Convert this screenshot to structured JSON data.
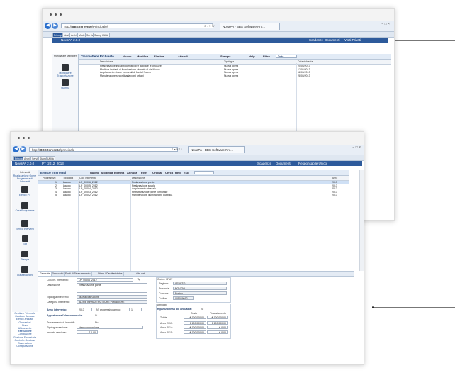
{
  "callouts": {
    "colors": {
      "line": "#777777",
      "dot": "#222222"
    }
  },
  "window_back": {
    "address": {
      "host": "http://",
      "bold": "BBSItervento",
      "rest": "/Principale/"
    },
    "address_controls": "⌕ ▾ × ↻",
    "tab_label": "NovaPA - BBS Software Pro...",
    "win_controls": "− □ ×",
    "app_tabs": [
      "Principale",
      "Novità",
      "Archivi",
      "Modelli",
      "Servizi",
      "Stampe",
      "Utilità"
    ],
    "brand": "NovaPA 2.0.0",
    "header_right": [
      "Scadenze",
      "Documenti",
      "Visiti Privati"
    ],
    "sidebar": {
      "title": "Mondialare Manager",
      "tool1": "Mondialare Trasportazione",
      "tool2": "Stampa"
    },
    "panel_title": "Trasmettere Richieste",
    "toolbar": [
      "Nuovo",
      "Modifica",
      "Elimina",
      "Attendi",
      "Stampa",
      "Help",
      "Filtro"
    ],
    "filter_value": "Tutte",
    "columns": [
      "Descrizione",
      "Tipologia",
      "Data richiesta"
    ],
    "rows": [
      {
        "desc": "Realizzazione impianti domotici per facilitare le chiusure",
        "type": "Nuova opera",
        "date": "20/06/2013"
      },
      {
        "desc": "Modifica impianti di illuminazione stradale di via Nuova",
        "type": "Nuova opera",
        "date": "12/06/2013"
      },
      {
        "desc": "Ampliamento strade comunali di Castel Nuovo",
        "type": "Nuova opera",
        "date": "12/06/2013"
      },
      {
        "desc": "Manutenzione straordinaria ponti urbani",
        "type": "Nuova opera",
        "date": "28/05/2013"
      }
    ]
  },
  "window_front": {
    "address": {
      "host": "http://",
      "bold": "BBSItervento",
      "rest": "/principale"
    },
    "address_controls": "⌕ ▾ × ↻",
    "tab_label": "NovaPA - BBS Software Pro...",
    "win_controls": "− □ ×",
    "app_tabs": [
      "Principale",
      "Archivi",
      "Servizi",
      "Stampe",
      "Utilità"
    ],
    "brand": "NovaPA 2.0.0",
    "header_code": "PT_2012_2013",
    "header_right": [
      "Scadenze",
      "Documenti",
      "Responsabile Unico"
    ],
    "sidebar": {
      "title": "Interventi",
      "items": [
        "Realizzazione Opere",
        "Programma di Interventi"
      ],
      "tools": [
        "Elenco PT",
        "Crea Programma",
        "Elenco Interventi",
        "Edit",
        "Stampa",
        "Classificazioni"
      ],
      "links": [
        "Gestione Triennale",
        "Gestione Annuale",
        "Elenco annuale",
        "Operazioni",
        "Stato",
        "Affidamento",
        "Esecuzione",
        "Conclusione",
        "Gestione Finanziaria",
        "Controllo Gestione",
        "Osservatorio",
        "Configurazione"
      ]
    },
    "panel_title": "Elenco Interventi",
    "toolbar": [
      "Nuovo",
      "Modifica",
      "Elimina",
      "Annulla",
      "Filtri",
      "Ordina",
      "Cerca",
      "Help",
      "Esci"
    ],
    "filter_value": "",
    "columns": [
      "Progressivo",
      "Tipologia",
      "Cod. Intervento",
      "Descrizione",
      "Anno"
    ],
    "rows": [
      {
        "prog": "1",
        "type": "Lavoro",
        "code": "LP_00006_2012",
        "desc": "Realizzazione ponte",
        "year": "2013"
      },
      {
        "prog": "2",
        "type": "Lavoro",
        "code": "LP_00005_2012",
        "desc": "Realizzazione scuola",
        "year": "2013"
      },
      {
        "prog": "3",
        "type": "Lavoro",
        "code": "LP_00004_2012",
        "desc": "Ampliamento stradale",
        "year": "2013"
      },
      {
        "prog": "4",
        "type": "Lavoro",
        "code": "LP_00003_2012",
        "desc": "Ristrutturazione ponte comunale",
        "year": "2013"
      },
      {
        "prog": "5",
        "type": "Lavoro",
        "code": "LP_00002_2012",
        "desc": "Manutenzione illuminazione pubblica",
        "year": "2013"
      }
    ],
    "form": {
      "tabs": [
        "Generale",
        "Elenco dei",
        "Fonti di Finanziamento",
        "Stime / Caratteristiche",
        "Altri dati"
      ],
      "left": {
        "cod_label": "Cod. Int. Intervento:",
        "cod_value": "LP_00006_2012",
        "desc_label": "Descrizione:",
        "desc_value": "Realizzazione ponte",
        "tipologia_label": "Tipologia Intervento:",
        "tipologia_value": "Nuova costruzione",
        "categoria_label": "Categoria Intervento:",
        "categoria_value": "ALTRE INFRASTRUTTURE PUBBLICHE",
        "anno_label": "Anno intervento:",
        "anno_value": "2013",
        "prog_label": "N° progressivo annuo:",
        "prog_value": "1",
        "appart_label": "Appartiene all'elenco annuale:",
        "appart_value": "Sì",
        "trasf_label": "Trasferimento di immobili:",
        "trasf_value": "No",
        "tip_ces_label": "Tipologia cessione:",
        "tip_ces_value": "Nessuna cessione",
        "importo_label": "Importo cessione:",
        "importo_value": "€ 0,00"
      },
      "right": {
        "istat_title": "Codice ISTAT",
        "regione_label": "Regione:",
        "regione_value": "VENETO",
        "provincia_label": "Provincia:",
        "provincia_value": "ROVIGO",
        "comune_label": "Comune:",
        "comune_value": "Rovigo",
        "codice_label": "Codice:",
        "codice_value": "005029012",
        "altri_title": "Altri dati",
        "rip_label": "Ripartizione su più annualità:",
        "rip_value": "Sì",
        "col_headers": [
          "Costo",
          "Finanziamento"
        ],
        "rows": [
          {
            "label": "Totale",
            "costo": "€ 100.000,00",
            "fin": "€ 100.000,00"
          },
          {
            "label": "Anno 2013:",
            "costo": "€ 100.000,00",
            "fin": "€ 100.000,00"
          },
          {
            "label": "Anno 2014:",
            "costo": "€ 100.000,00",
            "fin": "€ 0,00"
          },
          {
            "label": "Anno 2015:",
            "costo": "€ 100.000,00",
            "fin": "€ 0,00"
          }
        ]
      }
    }
  }
}
